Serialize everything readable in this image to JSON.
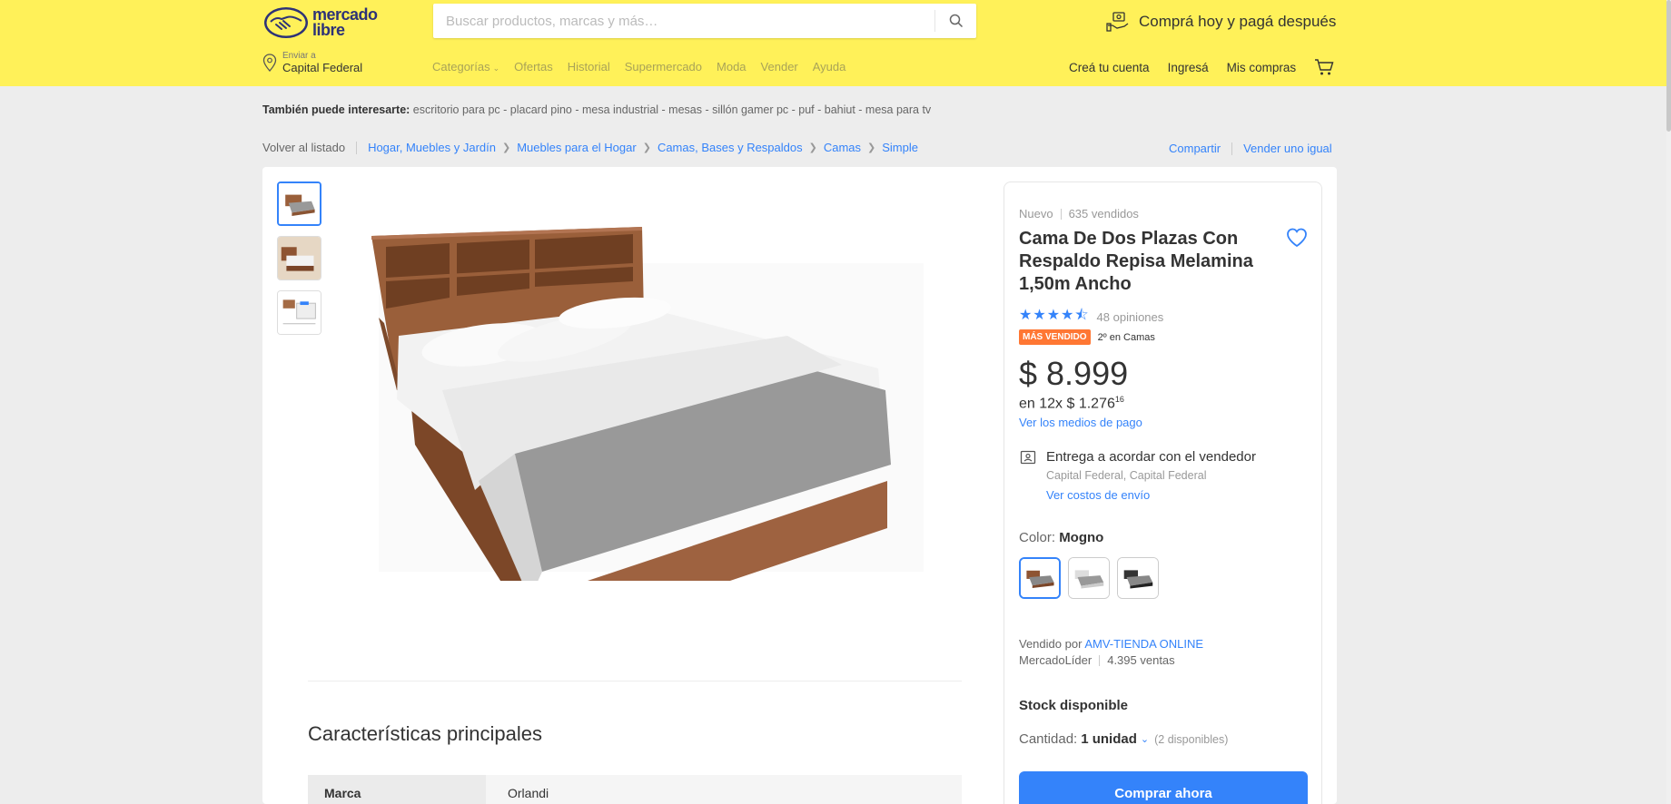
{
  "header": {
    "logo_text_line1": "mercado",
    "logo_text_line2": "libre",
    "search_placeholder": "Buscar productos, marcas y más…",
    "promo": "Comprá hoy y pagá después",
    "location_label": "Enviar a",
    "location_value": "Capital Federal",
    "nav": [
      "Categorías",
      "Ofertas",
      "Historial",
      "Supermercado",
      "Moda",
      "Vender",
      "Ayuda"
    ],
    "user_nav": [
      "Creá tu cuenta",
      "Ingresá",
      "Mis compras"
    ]
  },
  "interest": {
    "label": "También puede interesarte:",
    "items": "escritorio para pc - placard pino - mesa industrial - mesas - sillón gamer pc - puf - bahiut - mesa para tv"
  },
  "breadcrumb": {
    "back": "Volver al listado",
    "items": [
      "Hogar, Muebles y Jardín",
      "Muebles para el Hogar",
      "Camas, Bases y Respaldos",
      "Camas",
      "Simple"
    ],
    "share": "Compartir",
    "sell_same": "Vender uno igual"
  },
  "product": {
    "condition": "Nuevo",
    "sold": "635 vendidos",
    "title": "Cama De Dos Plazas Con Respaldo Repisa Melamina 1,50m Ancho",
    "rating": 4.5,
    "reviews": "48 opiniones",
    "badge": "MÁS VENDIDO",
    "rank": "2º en Camas",
    "price": "$ 8.999",
    "installments": "en 12x $ 1.276",
    "installments_sup": "16",
    "payment_link": "Ver los medios de pago",
    "shipping_title": "Entrega a acordar con el vendedor",
    "shipping_location": "Capital Federal, Capital Federal",
    "shipping_link": "Ver costos de envío",
    "color_label": "Color:",
    "color_value": "Mogno",
    "seller_prefix": "Vendido por",
    "seller_name": "AMV-TIENDA ONLINE",
    "seller_level": "MercadoLíder",
    "seller_sales": "4.395 ventas",
    "stock": "Stock disponible",
    "qty_label": "Cantidad:",
    "qty_value": "1 unidad",
    "qty_available": "(2 disponibles)",
    "buy_now": "Comprar ahora"
  },
  "features": {
    "title": "Características principales",
    "rows": [
      {
        "key": "Marca",
        "value": "Orlandi"
      }
    ]
  },
  "colors": {
    "accent": "#3483fa",
    "header_bg": "#fff159",
    "badge": "#ff7733",
    "wood": "#9a5f3a"
  }
}
